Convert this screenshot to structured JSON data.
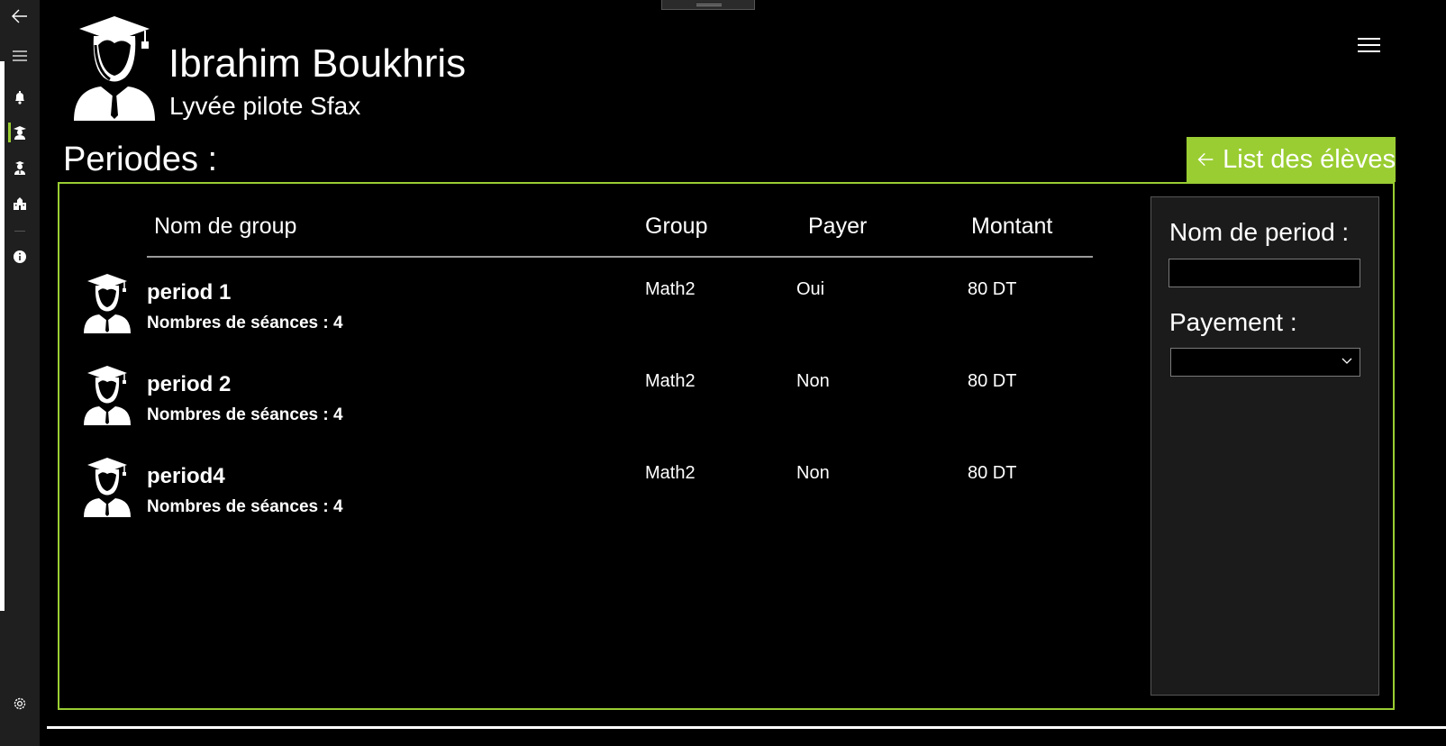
{
  "header": {
    "user_name": "Ibrahim Boukhris",
    "school": "Lyvée pilote Sfax"
  },
  "page": {
    "title": "Periodes :",
    "back_button_label": "List des élèves"
  },
  "table": {
    "columns": [
      "Nom de group",
      "Group",
      "Payer",
      "Montant"
    ],
    "rows": [
      {
        "name": "period 1",
        "sessions": "Nombres de séances  : 4",
        "group": "Math2",
        "payer": "Oui",
        "montant": "80 DT"
      },
      {
        "name": "period 2",
        "sessions": "Nombres de séances  : 4",
        "group": "Math2",
        "payer": "Non",
        "montant": "80 DT"
      },
      {
        "name": "period4",
        "sessions": "Nombres de séances  : 4",
        "group": "Math2",
        "payer": "Non",
        "montant": "80 DT"
      }
    ]
  },
  "form": {
    "period_name_label": "Nom de period :",
    "period_name_value": "",
    "payment_label": "Payement :",
    "payment_selected": ""
  },
  "nav": {
    "items": [
      "back-icon",
      "menu-icon",
      "bell-icon",
      "student-icon",
      "teacher-icon",
      "school-icon",
      "info-icon",
      "settings-icon"
    ],
    "selected": "student-icon"
  },
  "colors": {
    "accent": "#9acd32",
    "background": "#000000",
    "rail": "#1f1f1f",
    "side_panel": "#1b1b1b"
  }
}
